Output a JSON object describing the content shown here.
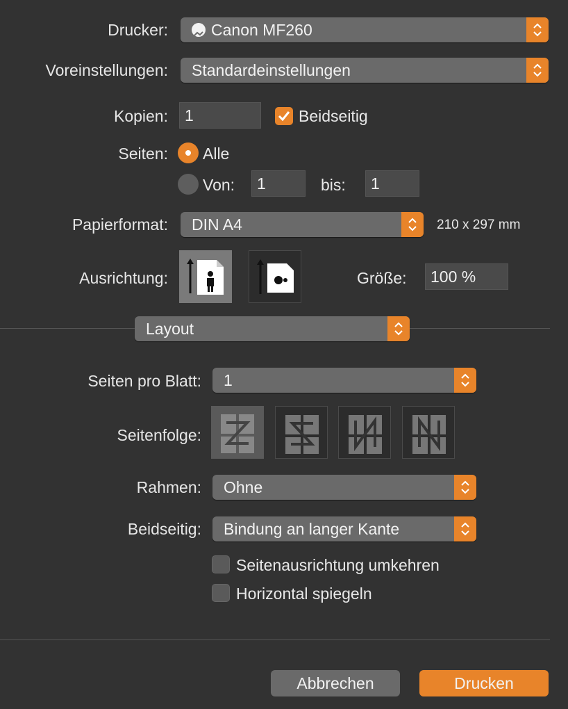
{
  "printer": {
    "label": "Drucker:",
    "value": "Canon MF260"
  },
  "presets": {
    "label": "Voreinstellungen:",
    "value": "Standardeinstellungen"
  },
  "copies": {
    "label": "Kopien:",
    "value": "1",
    "duplex_label": "Beidseitig",
    "duplex_checked": true
  },
  "pages": {
    "label": "Seiten:",
    "all_label": "Alle",
    "from_label": "Von:",
    "from_value": "1",
    "to_label": "bis:",
    "to_value": "1",
    "selected": "all"
  },
  "paper": {
    "label": "Papierformat:",
    "value": "DIN A4",
    "dimensions": "210 x 297 mm"
  },
  "orientation": {
    "label": "Ausrichtung:",
    "selected": "portrait"
  },
  "scale": {
    "label": "Größe:",
    "value": "100 %"
  },
  "section": {
    "value": "Layout"
  },
  "layout": {
    "pages_per_sheet_label": "Seiten pro Blatt:",
    "pages_per_sheet_value": "1",
    "order_label": "Seitenfolge:",
    "border_label": "Rahmen:",
    "border_value": "Ohne",
    "twosided_label": "Beidseitig:",
    "twosided_value": "Bindung an langer Kante",
    "reverse_label": "Seitenausrichtung umkehren",
    "reverse_checked": false,
    "flip_label": "Horizontal spiegeln",
    "flip_checked": false
  },
  "buttons": {
    "cancel": "Abbrechen",
    "print": "Drucken"
  },
  "colors": {
    "accent": "#e8842a",
    "background": "#323232"
  }
}
